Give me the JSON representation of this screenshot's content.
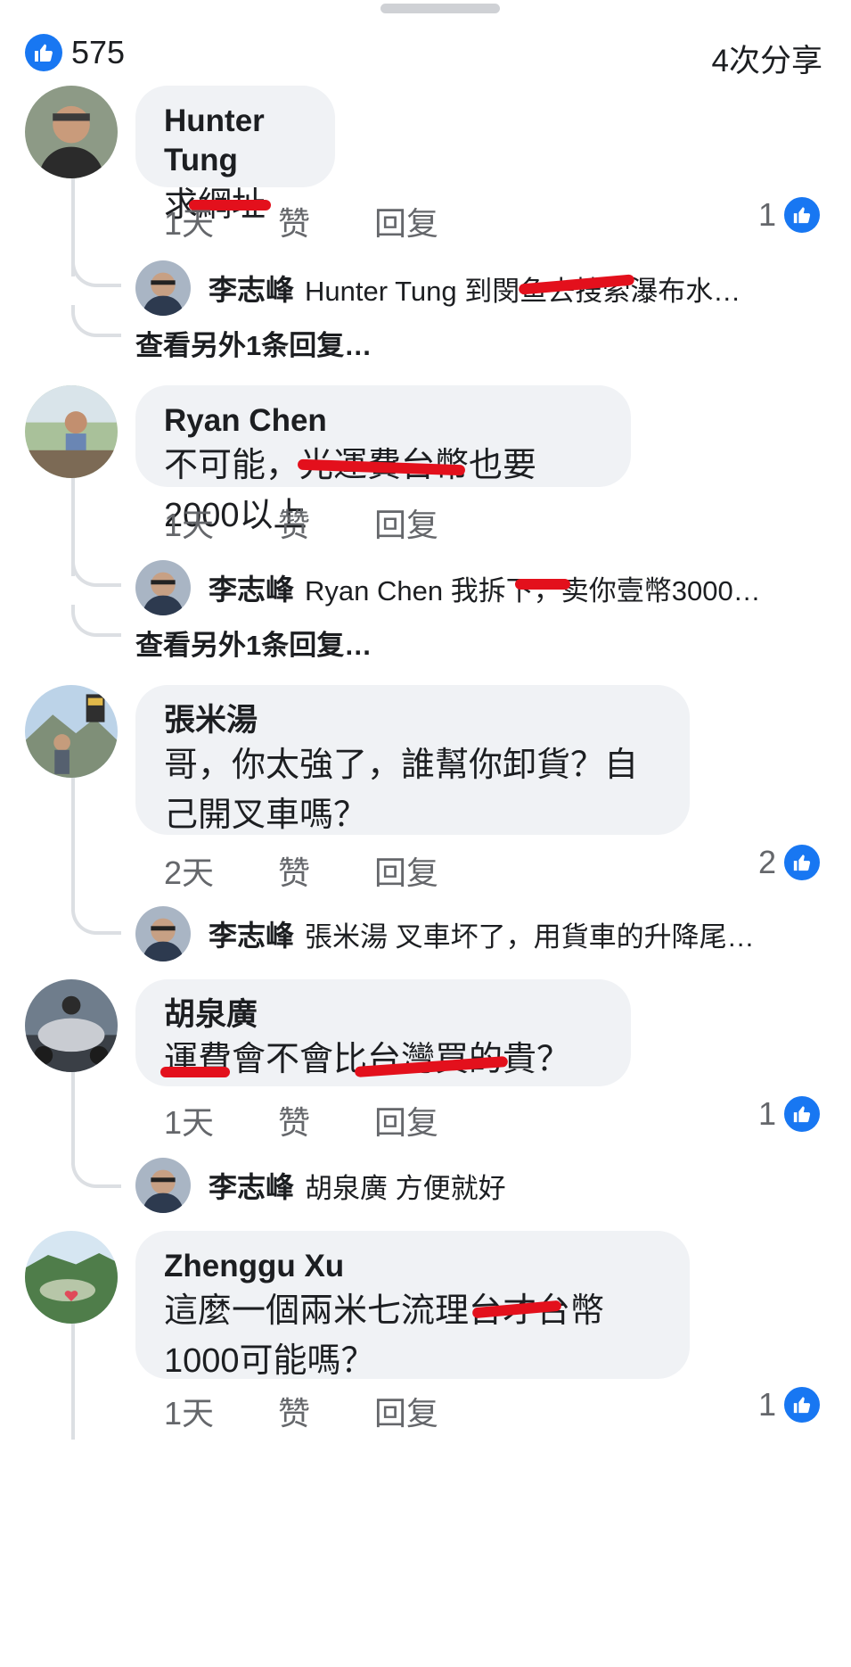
{
  "header": {
    "like_count": "575",
    "shares": "4次分享"
  },
  "actions": {
    "like": "赞",
    "reply": "回复"
  },
  "comments": [
    {
      "author": "Hunter Tung",
      "text": "求網址",
      "time": "1天",
      "reactions": "1",
      "reply": {
        "name": "李志峰",
        "text": "Hunter Tung 到閔鱼去搜索瀑布水…"
      },
      "more_replies": "查看另外1条回复…"
    },
    {
      "author": "Ryan Chen",
      "text": "不可能，光運費台幣也要2000以上",
      "time": "1天",
      "reactions": "",
      "reply": {
        "name": "李志峰",
        "text": "Ryan Chen 我拆下，卖你壹幣3000…"
      },
      "more_replies": "查看另外1条回复…"
    },
    {
      "author": "張米湯",
      "text": "哥，你太強了，誰幫你卸貨？自己開叉車嗎？",
      "time": "2天",
      "reactions": "2",
      "reply": {
        "name": "李志峰",
        "text": "張米湯 叉車坏了，用貨車的升降尾…"
      }
    },
    {
      "author": "胡泉廣",
      "text": "運費會不會比台灣買的貴？",
      "time": "1天",
      "reactions": "1",
      "reply": {
        "name": "李志峰",
        "text": "胡泉廣 方便就好"
      }
    },
    {
      "author": "Zhenggu Xu",
      "text": "這麼一個兩米七流理台才台幣1000可能嗎？",
      "time": "1天",
      "reactions": "1"
    }
  ],
  "icons": {
    "like": "thumbs-up-icon"
  },
  "colors": {
    "accent": "#1877f2",
    "redaction": "#e3101c",
    "bubble": "#f0f2f5"
  }
}
